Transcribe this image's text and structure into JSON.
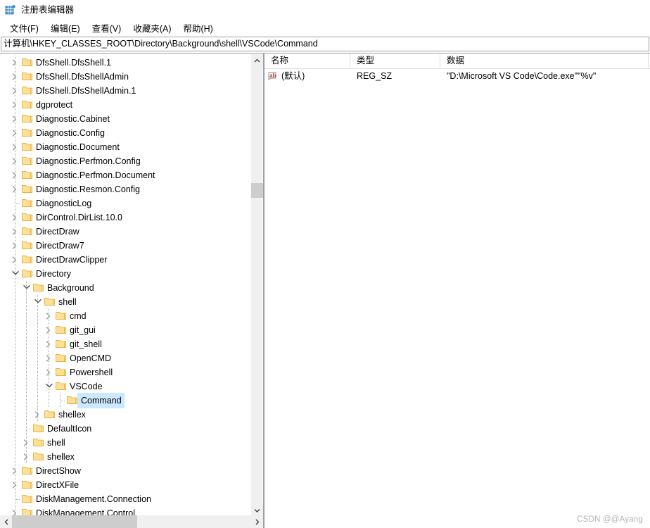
{
  "window": {
    "title": "注册表编辑器",
    "app_icon": "registry-editor-icon"
  },
  "menubar": {
    "items": [
      {
        "label": "文件(F)",
        "name": "menu-file"
      },
      {
        "label": "编辑(E)",
        "name": "menu-edit"
      },
      {
        "label": "查看(V)",
        "name": "menu-view"
      },
      {
        "label": "收藏夹(A)",
        "name": "menu-favorites"
      },
      {
        "label": "帮助(H)",
        "name": "menu-help"
      }
    ]
  },
  "address": {
    "path": "计算机\\HKEY_CLASSES_ROOT\\Directory\\Background\\shell\\VSCode\\Command"
  },
  "tree": {
    "nodes": [
      {
        "label": "DfsShell.DfsShell.1",
        "depth": 1,
        "state": "collapsed"
      },
      {
        "label": "DfsShell.DfsShellAdmin",
        "depth": 1,
        "state": "collapsed"
      },
      {
        "label": "DfsShell.DfsShellAdmin.1",
        "depth": 1,
        "state": "collapsed"
      },
      {
        "label": "dgprotect",
        "depth": 1,
        "state": "collapsed"
      },
      {
        "label": "Diagnostic.Cabinet",
        "depth": 1,
        "state": "collapsed"
      },
      {
        "label": "Diagnostic.Config",
        "depth": 1,
        "state": "collapsed"
      },
      {
        "label": "Diagnostic.Document",
        "depth": 1,
        "state": "collapsed"
      },
      {
        "label": "Diagnostic.Perfmon.Config",
        "depth": 1,
        "state": "collapsed"
      },
      {
        "label": "Diagnostic.Perfmon.Document",
        "depth": 1,
        "state": "collapsed"
      },
      {
        "label": "Diagnostic.Resmon.Config",
        "depth": 1,
        "state": "collapsed"
      },
      {
        "label": "DiagnosticLog",
        "depth": 1,
        "state": "leaf"
      },
      {
        "label": "DirControl.DirList.10.0",
        "depth": 1,
        "state": "collapsed"
      },
      {
        "label": "DirectDraw",
        "depth": 1,
        "state": "collapsed"
      },
      {
        "label": "DirectDraw7",
        "depth": 1,
        "state": "collapsed"
      },
      {
        "label": "DirectDrawClipper",
        "depth": 1,
        "state": "collapsed"
      },
      {
        "label": "Directory",
        "depth": 1,
        "state": "expanded"
      },
      {
        "label": "Background",
        "depth": 2,
        "state": "expanded"
      },
      {
        "label": "shell",
        "depth": 3,
        "state": "expanded"
      },
      {
        "label": "cmd",
        "depth": 4,
        "state": "collapsed"
      },
      {
        "label": "git_gui",
        "depth": 4,
        "state": "collapsed"
      },
      {
        "label": "git_shell",
        "depth": 4,
        "state": "collapsed"
      },
      {
        "label": "OpenCMD",
        "depth": 4,
        "state": "collapsed"
      },
      {
        "label": "Powershell",
        "depth": 4,
        "state": "collapsed"
      },
      {
        "label": "VSCode",
        "depth": 4,
        "state": "expanded"
      },
      {
        "label": "Command",
        "depth": 5,
        "state": "leaf",
        "selected": true
      },
      {
        "label": "shellex",
        "depth": 3,
        "state": "collapsed"
      },
      {
        "label": "DefaultIcon",
        "depth": 2,
        "state": "leaf"
      },
      {
        "label": "shell",
        "depth": 2,
        "state": "collapsed"
      },
      {
        "label": "shellex",
        "depth": 2,
        "state": "collapsed"
      },
      {
        "label": "DirectShow",
        "depth": 1,
        "state": "collapsed"
      },
      {
        "label": "DirectXFile",
        "depth": 1,
        "state": "collapsed"
      },
      {
        "label": "DiskManagement.Connection",
        "depth": 1,
        "state": "leaf"
      },
      {
        "label": "DiskManagement.Control",
        "depth": 1,
        "state": "collapsed"
      }
    ]
  },
  "values": {
    "columns": [
      "名称",
      "类型",
      "数据"
    ],
    "rows": [
      {
        "name": "(默认)",
        "icon": "ab-string-icon",
        "type": "REG_SZ",
        "data": "\"D:\\Microsoft VS Code\\Code.exe\"\"%v\""
      }
    ]
  },
  "scrollbars": {
    "tree_vertical": {
      "up_arrow": "chevron-up-icon",
      "down_arrow": "chevron-down-icon"
    },
    "tree_horizontal": {
      "left_arrow": "chevron-left-icon",
      "right_arrow": "chevron-right-icon"
    }
  },
  "watermark": {
    "text": "CSDN @@Ayang"
  },
  "colors": {
    "selection": "#cce8ff",
    "folder_fill": "#ffe09b",
    "folder_edge": "#e8b23a",
    "border": "#9aa0a6",
    "scroll_track": "#f0f0f0",
    "scroll_thumb": "#cdcdcd"
  }
}
